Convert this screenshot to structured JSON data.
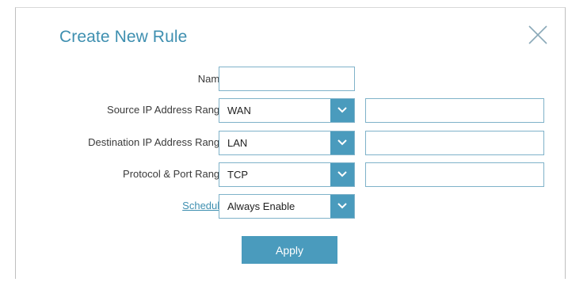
{
  "dialog": {
    "title": "Create New Rule",
    "close_icon": "close-icon"
  },
  "form": {
    "name": {
      "label": "Name:",
      "value": ""
    },
    "source_ip_range": {
      "label": "Source IP Address Range:",
      "selected": "WAN",
      "text_value": ""
    },
    "destination_ip_range": {
      "label": "Destination IP Address Range:",
      "selected": "LAN",
      "text_value": ""
    },
    "protocol_port_range": {
      "label": "Protocol & Port Range:",
      "selected": "TCP",
      "text_value": ""
    },
    "schedule": {
      "label": "Schedule:",
      "selected": "Always Enable"
    }
  },
  "actions": {
    "apply_label": "Apply"
  },
  "colors": {
    "accent": "#4a9bbd",
    "title": "#3e8fb0",
    "border": "#7fb2c9"
  }
}
